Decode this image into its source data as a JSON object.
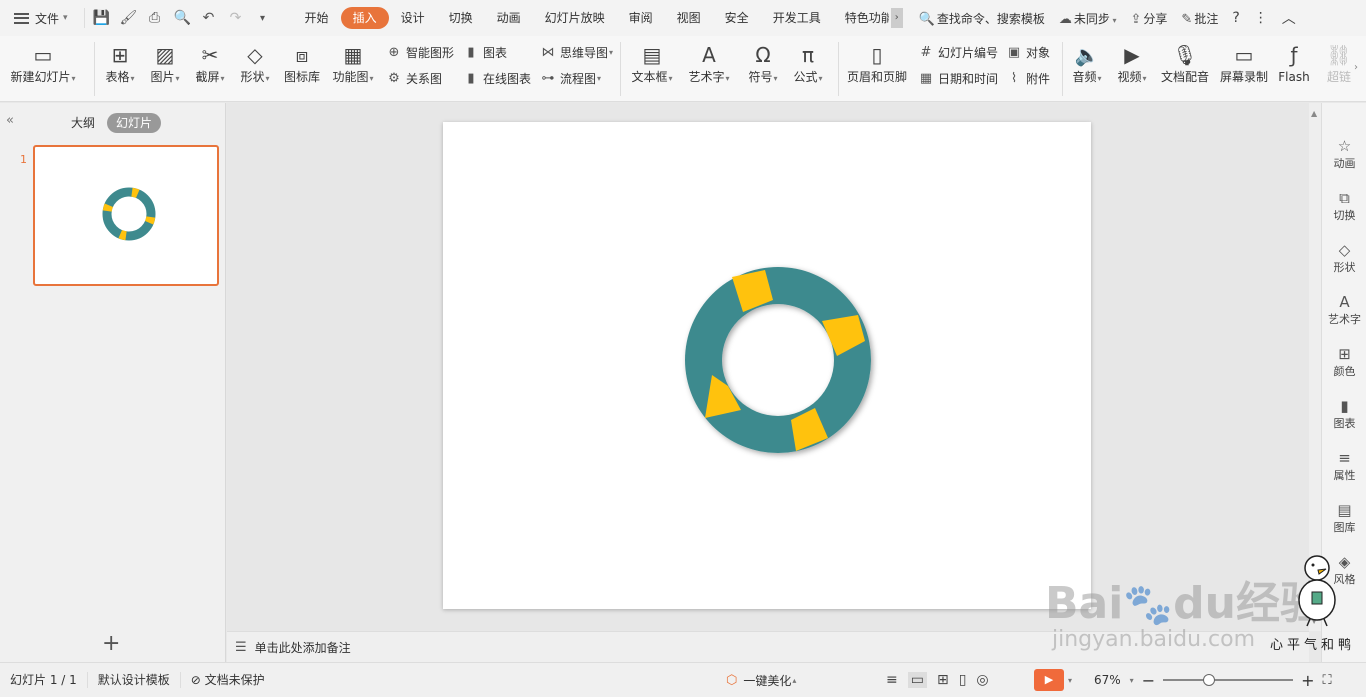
{
  "menubar": {
    "file_label": "文件",
    "tabs": [
      "开始",
      "插入",
      "设计",
      "切换",
      "动画",
      "幻灯片放映",
      "审阅",
      "视图",
      "安全",
      "开发工具",
      "特色功能"
    ],
    "active_tab": "插入",
    "search_label": "查找命令、搜索模板",
    "sync_label": "未同步",
    "share_label": "分享",
    "comment_label": "批注"
  },
  "ribbon": {
    "new_slide": "新建幻灯片",
    "table": "表格",
    "picture": "图片",
    "screenshot": "截屏",
    "shape": "形状",
    "icon_lib": "图标库",
    "func_chart": "功能图",
    "smart_art": "智能图形",
    "chart": "图表",
    "relation": "关系图",
    "online_chart": "在线图表",
    "mindmap": "思维导图",
    "flowchart": "流程图",
    "textbox": "文本框",
    "wordart": "艺术字",
    "symbol": "符号",
    "formula": "公式",
    "header_footer": "页眉和页脚",
    "slide_number": "幻灯片编号",
    "object": "对象",
    "date_time": "日期和时间",
    "attachment": "附件",
    "audio": "音频",
    "video": "视频",
    "doc_dubbing": "文档配音",
    "screen_record": "屏幕录制",
    "flash": "Flash",
    "hyperlink": "超链"
  },
  "left_panel": {
    "outline_tab": "大纲",
    "slides_tab": "幻灯片",
    "slide_number": "1"
  },
  "notes_placeholder": "单击此处添加备注",
  "right_sidebar": [
    "动画",
    "切换",
    "形状",
    "艺术字",
    "颜色",
    "图表",
    "属性",
    "图库",
    "风格"
  ],
  "statusbar": {
    "slide_info": "幻灯片 1 / 1",
    "template": "默认设计模板",
    "protect": "文档未保护",
    "beautify": "一键美化",
    "zoom": "67%",
    "zoom_level": 0.35
  },
  "watermark": {
    "brand": "Bai",
    "brand_tail": "经验",
    "url": "jingyan.baidu.com",
    "signature": "心平气和鸭"
  },
  "colors": {
    "accent": "#e8743b",
    "ring_teal": "#3e8a8e",
    "ring_yellow": "#ffc20e"
  }
}
